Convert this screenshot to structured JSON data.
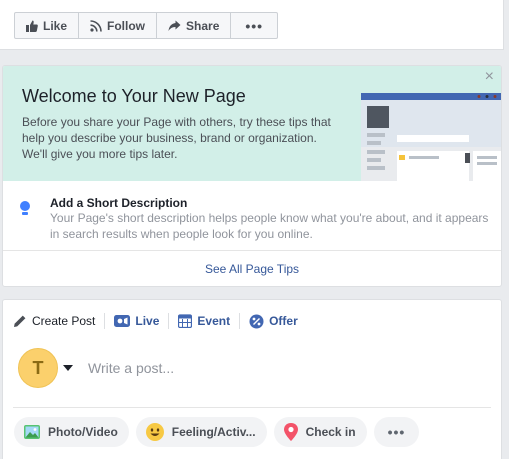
{
  "actions": {
    "like": "Like",
    "follow": "Follow",
    "share": "Share",
    "more": "•••"
  },
  "welcome": {
    "title": "Welcome to Your New Page",
    "body": "Before you share your Page with others, try these tips that help you describe your business, brand or organization. We'll give you more tips later.",
    "close": "×",
    "tip_title": "Add a Short Description",
    "tip_desc": "Your Page's short description helps people know what you're about, and it appears in search results when people look for you online.",
    "see_all": "See All Page Tips"
  },
  "composer": {
    "tabs": {
      "create_post": "Create Post",
      "live": "Live",
      "event": "Event",
      "offer": "Offer"
    },
    "avatar_letter": "T",
    "placeholder": "Write a post...",
    "options": {
      "photo_video": "Photo/Video",
      "feeling": "Feeling/Activ...",
      "check_in": "Check in",
      "more": "•••"
    }
  },
  "colors": {
    "banner_bg": "#d2efe8",
    "link_blue": "#365899",
    "tip_blue": "#4080ff",
    "avatar_yellow": "#fbd06c"
  }
}
